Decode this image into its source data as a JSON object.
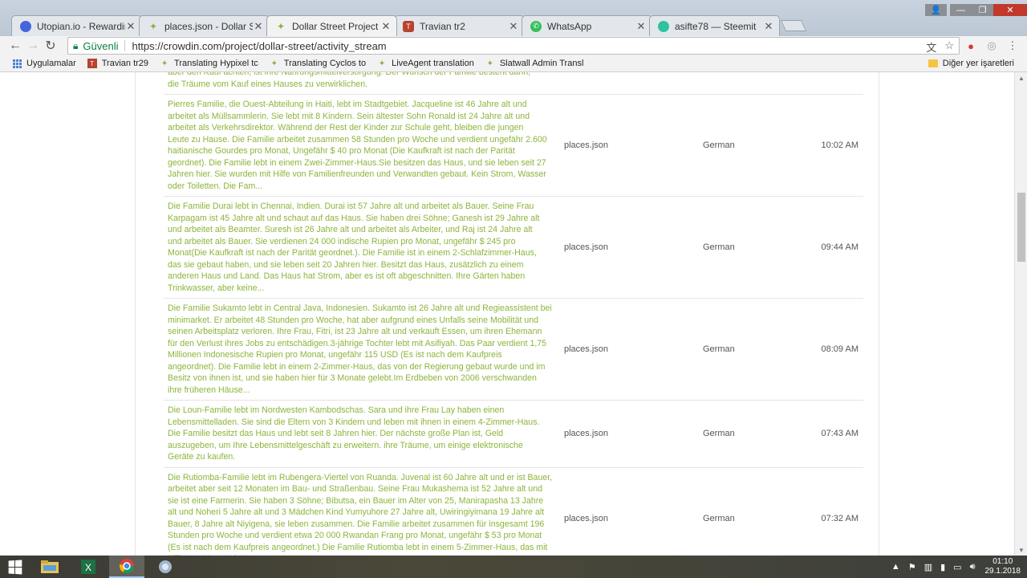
{
  "browser": {
    "tabs": [
      {
        "title": "Utopian.io - Rewarding O",
        "favicon_color": "#4466dd"
      },
      {
        "title": "places.json - Dollar Stree",
        "favicon_color": "#8ab04a"
      },
      {
        "title": "Dollar Street Project Actio",
        "favicon_color": "#8ab04a",
        "active": true
      },
      {
        "title": "Travian tr2",
        "favicon_color": "#b8432e"
      },
      {
        "title": "WhatsApp",
        "favicon_color": "#35c05a"
      },
      {
        "title": "asifte78 — Steemit",
        "favicon_color": "#2ec2a0"
      }
    ],
    "secure_label": "Güvenli",
    "url": "https://crowdin.com/project/dollar-street/activity_stream"
  },
  "bookmarks": {
    "apps_label": "Uygulamalar",
    "items": [
      {
        "label": "Travian tr29",
        "icon_color": "#b8432e"
      },
      {
        "label": "Translating Hypixel tc",
        "icon_color": "#8ab04a"
      },
      {
        "label": "Translating Cyclos to",
        "icon_color": "#8ab04a"
      },
      {
        "label": "LiveAgent translation",
        "icon_color": "#8ab04a"
      },
      {
        "label": "Slatwall Admin Transl",
        "icon_color": "#8ab04a"
      }
    ],
    "other_label": "Diğer yer işaretleri"
  },
  "activity": {
    "rows": [
      {
        "text": "aber den Kauf achten, ist ihre Nahrungsmittelversorgung. Der Wunsch der Familie besteht darin,\ndie Träume vom Kauf eines Hauses zu verwirklichen.",
        "file": "",
        "language": "",
        "time": ""
      },
      {
        "text": "Pierres Familie, die Ouest-Abteilung in Haiti, lebt im Stadtgebiet. Jacqueline ist 46 Jahre alt und\narbeitet als Müllsammlerin. Sie lebt mit 8 Kindern. Sein ältester Sohn Ronald ist 24 Jahre alt und\narbeitet als Verkehrsdirektor. Während der Rest der Kinder zur Schule geht, bleiben die jungen\nLeute zu Hause. Die Familie arbeitet zusammen 58 Stunden pro Woche und verdient ungefähr 2.600\nhaitianische Gourdes pro Monat, Ungefähr $ 40 pro Monat (Die Kaufkraft ist nach der Parität\ngeordnet). Die Familie lebt in einem Zwei-Zimmer-Haus.Sie besitzen das Haus, und sie leben seit 27\nJahren hier. Sie wurden mit Hilfe von Familienfreunden und Verwandten gebaut. Kein Strom, Wasser\noder Toiletten. Die Fam...",
        "file": "places.json",
        "language": "German",
        "time": "10:02 AM"
      },
      {
        "text": "Die Familie Durai lebt in Chennai, Indien. Durai ist 57 Jahre alt und arbeitet als Bauer. Seine Frau\nKarpagam ist 45 Jahre alt und schaut auf das Haus. Sie haben drei Söhne; Ganesh ist 29 Jahre alt\nund arbeitet als Beamter. Suresh ist 26 Jahre alt und arbeitet als Arbeiter, und Raj ist 24 Jahre alt\nund arbeitet als Bauer. Sie verdienen 24 000 indische Rupien pro Monat, ungefähr $ 245 pro\nMonat(Die Kaufkraft ist nach der Parität geordnet.). Die Familie ist in einem 2-Schlafzimmer-Haus,\ndas sie gebaut haben, und sie leben seit 20 Jahren hier. Besitzt das Haus, zusätzlich zu einem\nanderen Haus und Land. Das Haus hat Strom, aber es ist oft abgeschnitten. Ihre Gärten haben\nTrinkwasser, aber keine...",
        "file": "places.json",
        "language": "German",
        "time": "09:44 AM"
      },
      {
        "text": "Die Familie Sukamto lebt in Central Java, Indonesien. Sukamto ist 26 Jahre alt und Regieassistent bei\nminimarket. Er arbeitet 48 Stunden pro Woche, hat aber aufgrund eines Unfalls seine Mobilität und\nseinen Arbeitsplatz verloren. Ihre Frau, Fitri, ist 23 Jahre alt und verkauft Essen, um ihren Ehemann\nfür den Verlust ihres Jobs zu entschädigen.3-jährige Tochter lebt mit Asifiyah. Das Paar verdient 1,75\nMillionen Indonesische Rupien pro Monat, ungefähr 115 USD (Es ist nach dem Kaufpreis\nangeordnet). Die Familie lebt in einem 2-Zimmer-Haus, das von der Regierung gebaut wurde und im\nBesitz von ihnen ist, und sie haben hier für 3 Monate gelebt.Im Erdbeben von 2006 verschwanden\nihre früheren Häuse...",
        "file": "places.json",
        "language": "German",
        "time": "08:09 AM"
      },
      {
        "text": "Die Loun-Familie lebt im Nordwesten Kambodschas. Sara und ihre Frau Lay haben einen\nLebensmittelladen. Sie sind die Eltern von 3 Kindern und leben mit ihnen in einem 4-Zimmer-Haus.\nDie Familie besitzt das Haus und lebt seit 8 Jahren hier. Der nächste große Plan ist, Geld\nauszugeben, um Ihre Lebensmittelgeschäft zu erweitern. ihre Träume, um einige elektronische\nGeräte zu kaufen.",
        "file": "places.json",
        "language": "German",
        "time": "07:43 AM"
      },
      {
        "text": "Die Rutiomba-Familie lebt im Rubengera-Viertel von Ruanda. Juvenal ist 60 Jahre alt und er ist Bauer,\narbeitet aber seit 12 Monaten im Bau- und Straßenbau. Seine Frau Mukashema ist 52 Jahre alt und\nsie ist eine Farmerin. Sie haben 3 Söhne; Bibutsa, ein Bauer im Alter von 25, Manirapasha 13 Jahre\nalt und Noheri 5 Jahre alt und 3 Mädchen Kind Yumyuhore 27 Jahre alt, Uwiringiyimana 19 Jahre alt\nBauer, 8 Jahre alt Niyigena, sie leben zusammen. Die Familie arbeitet zusammen für insgesamt 196\nStunden pro Woche und verdient etwa 20 000 Rwandan Frang pro Monat, ungefähr $ 53 pro Monat\n(Es ist nach dem Kaufpreis angeordnet.) Die Familie Rutiomba lebt in einem 5-Zimmer-Haus, das mit\nHilfe von Verwand...",
        "file": "places.json",
        "language": "German",
        "time": "07:32 AM"
      }
    ]
  },
  "taskbar": {
    "date": "29.1.2018",
    "time": "01:10"
  }
}
